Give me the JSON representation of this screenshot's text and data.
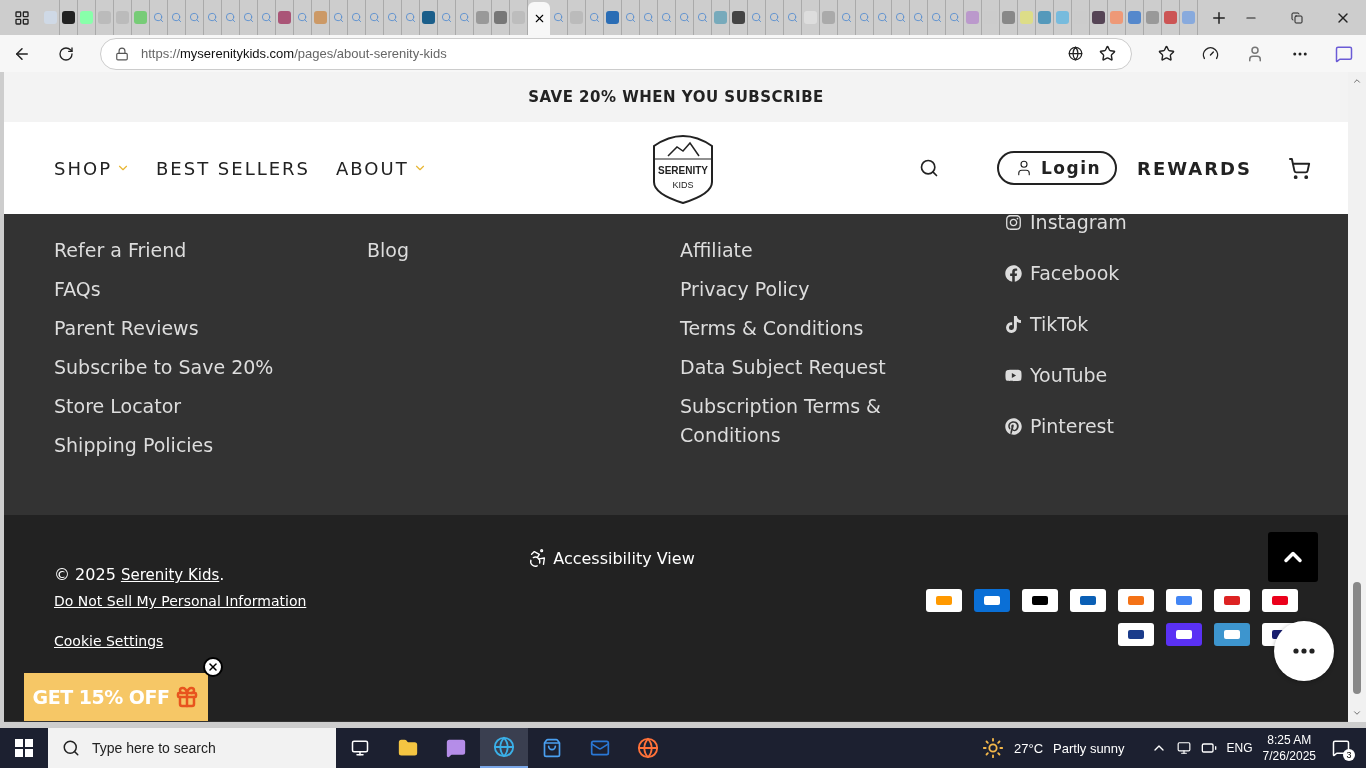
{
  "browser": {
    "url": {
      "scheme": "https://",
      "host": "myserenitykids.com",
      "path": "/pages/about-serenity-kids"
    }
  },
  "promo_bar": {
    "text": "SAVE 20% WHEN YOU SUBSCRIBE"
  },
  "header": {
    "nav": [
      {
        "label": "SHOP",
        "dropdown": true
      },
      {
        "label": "BEST SELLERS",
        "dropdown": false
      },
      {
        "label": "ABOUT",
        "dropdown": true
      }
    ],
    "logo": {
      "title": "SERENITY",
      "subtitle": "KIDS"
    },
    "login": "Login",
    "rewards": "REWARDS"
  },
  "footer": {
    "columns": [
      {
        "links": [
          "Refer a Friend",
          "FAQs",
          "Parent Reviews",
          "Subscribe to Save 20%",
          "Store Locator",
          "Shipping Policies"
        ]
      },
      {
        "links": [
          "Blog"
        ]
      },
      {
        "links": [
          "Affiliate",
          "Privacy Policy",
          "Terms & Conditions",
          "Data Subject Request",
          "Subscription Terms & Conditions"
        ]
      }
    ],
    "social": [
      {
        "label": "Instagram",
        "kind": "instagram"
      },
      {
        "label": "Facebook",
        "kind": "facebook"
      },
      {
        "label": "TikTok",
        "kind": "tiktok"
      },
      {
        "label": "YouTube",
        "kind": "youtube"
      },
      {
        "label": "Pinterest",
        "kind": "pinterest"
      }
    ]
  },
  "footer_bottom": {
    "copyright_prefix": "© 2025 ",
    "brand": "Serenity Kids",
    "copyright_suffix": ".",
    "links": [
      "Do Not Sell My Personal Information",
      "Cookie Settings"
    ],
    "accessibility": "Accessibility View"
  },
  "promo_badge": {
    "text": "GET 15% OFF"
  },
  "taskbar": {
    "search_placeholder": "Type here to search",
    "weather": {
      "temp": "27°C",
      "condition": "Partly sunny"
    },
    "language": "ENG",
    "time": "8:25 AM",
    "date": "7/26/2025",
    "notifications": "3"
  }
}
